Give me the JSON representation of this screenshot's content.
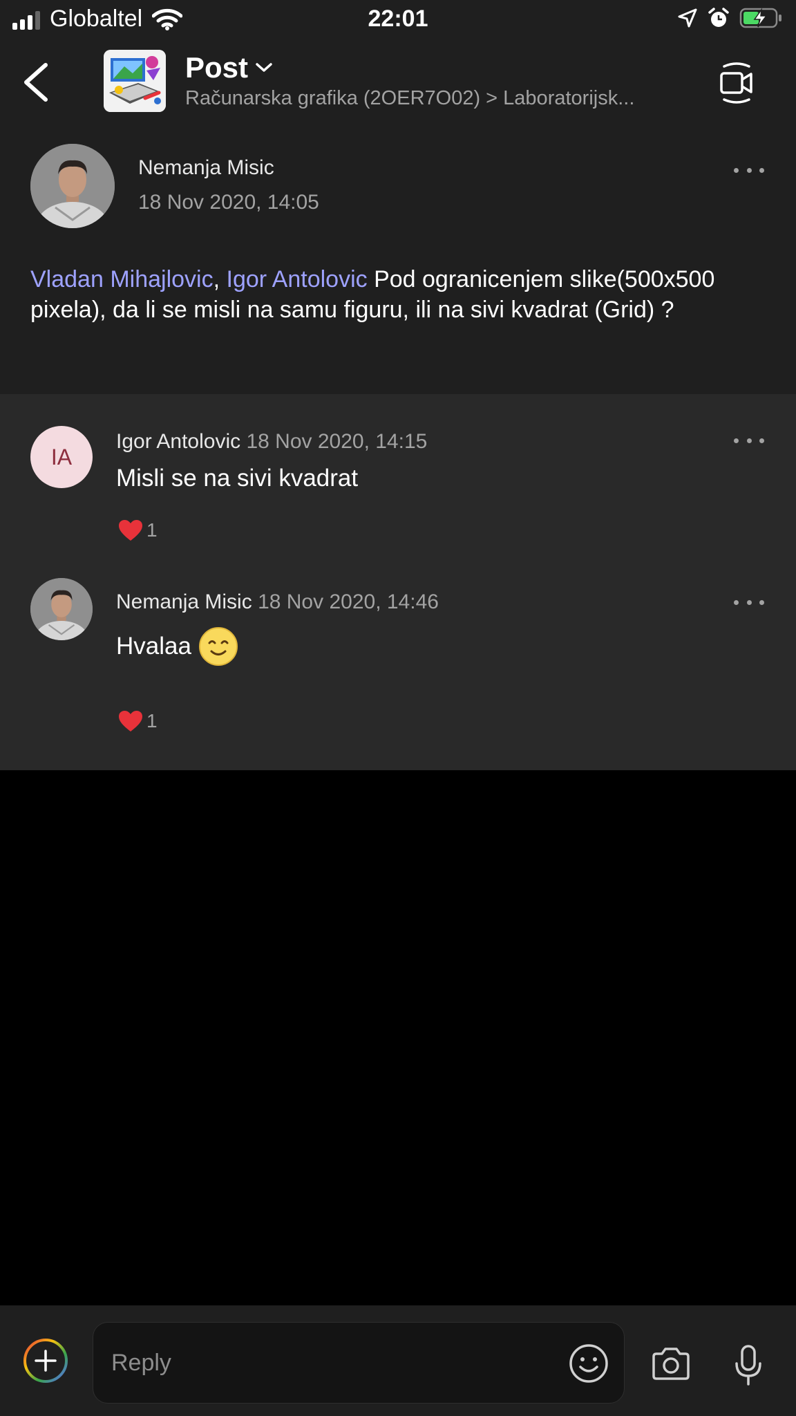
{
  "status_bar": {
    "carrier": "Globaltel",
    "time": "22:01"
  },
  "header": {
    "title": "Post",
    "subtitle": "Računarska grafika (2OER7O02) > Laboratorijsk..."
  },
  "post": {
    "author": "Nemanja Misic",
    "timestamp": "18 Nov 2020, 14:05",
    "mention_1": "Vladan Mihajlovic",
    "separator": ",",
    "mention_2": "Igor Antolovic",
    "text": "Pod ogranicenjem slike(500x500 pixela), da li se misli na samu figuru, ili na sivi kvadrat (Grid) ?"
  },
  "replies": [
    {
      "avatar_initials": "IA",
      "author": "Igor Antolovic",
      "timestamp": "18 Nov 2020, 14:15",
      "text": "Misli se na sivi kvadrat",
      "reaction_count": "1"
    },
    {
      "author": "Nemanja Misic",
      "timestamp": "18 Nov 2020, 14:46",
      "text": "Hvalaa",
      "reaction_count": "1"
    }
  ],
  "composer": {
    "placeholder": "Reply"
  },
  "colors": {
    "mention": "#9ea2ff",
    "reaction_heart": "#e8323a",
    "initials_bg": "#f4dbe0",
    "battery": "#4cd964"
  },
  "icons": [
    "signal-icon",
    "wifi-icon",
    "location-arrow-icon",
    "alarm-icon",
    "battery-icon",
    "back-chevron-icon",
    "chevron-down-icon",
    "video-call-icon",
    "more-icon",
    "heart-icon",
    "smiley-emoji-icon",
    "plus-icon",
    "emoji-icon",
    "camera-icon",
    "microphone-icon"
  ]
}
